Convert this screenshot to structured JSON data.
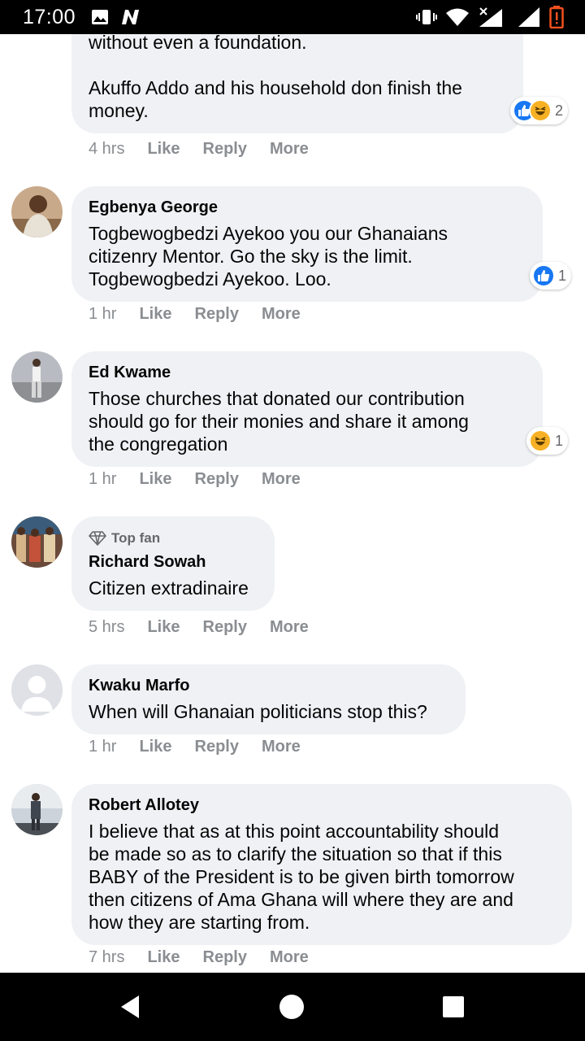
{
  "status_bar": {
    "time": "17:00"
  },
  "comments": [
    {
      "author": "",
      "top_fan": "",
      "lines": [
        "without even a foundation.",
        "",
        "Akuffo Addo and his household don finish the",
        "money."
      ],
      "time": "4 hrs",
      "reaction_count": "2",
      "reactions": [
        "like",
        "haha"
      ]
    },
    {
      "author": "Egbenya George",
      "top_fan": "",
      "lines": [
        "Togbewogbedzi Ayekoo you our Ghanaians",
        "citizenry Mentor. Go the sky is the limit.",
        "Togbewogbedzi Ayekoo. Loo."
      ],
      "time": "1 hr",
      "reaction_count": "1",
      "reactions": [
        "like"
      ]
    },
    {
      "author": "Ed Kwame",
      "top_fan": "",
      "lines": [
        "Those churches that donated our contribution",
        "should go for their monies and share it among",
        "the congregation"
      ],
      "time": "1 hr",
      "reaction_count": "1",
      "reactions": [
        "haha"
      ]
    },
    {
      "author": "Richard Sowah",
      "top_fan": "Top fan",
      "lines": [
        "Citizen extradinaire"
      ],
      "time": "5 hrs",
      "reaction_count": "",
      "reactions": []
    },
    {
      "author": "Kwaku Marfo",
      "top_fan": "",
      "lines": [
        "When will Ghanaian politicians stop this?"
      ],
      "time": "1 hr",
      "reaction_count": "",
      "reactions": []
    },
    {
      "author": "Robert Allotey",
      "top_fan": "",
      "lines": [
        "I believe that as at this point accountability should",
        "be made so as to clarify the situation so that if this",
        "BABY of the President is to be given birth tomorrow",
        "then citizens of Ama Ghana will where they are and",
        "how they are starting from."
      ],
      "time": "7 hrs",
      "reaction_count": "",
      "reactions": []
    }
  ],
  "actions": {
    "like": "Like",
    "reply": "Reply",
    "more": "More"
  },
  "colors": {
    "bubble_bg": "#eff1f4",
    "meta_text": "#8a8d91",
    "like_blue": "#1877f2",
    "haha_yellow": "#f7b125"
  }
}
